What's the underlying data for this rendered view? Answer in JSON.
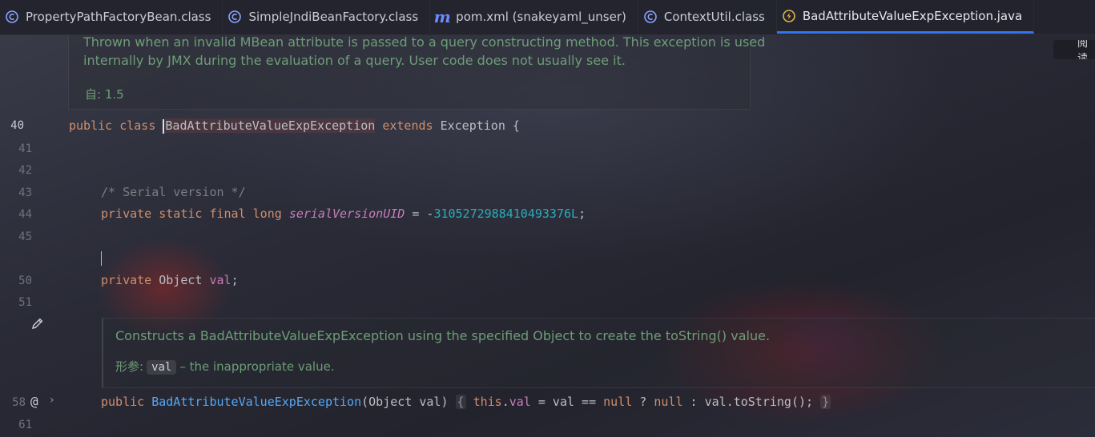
{
  "tabs": [
    {
      "label": "PropertyPathFactoryBean.class",
      "icon": "class-file-icon",
      "active": false
    },
    {
      "label": "SimpleJndiBeanFactory.class",
      "icon": "class-file-icon",
      "active": false
    },
    {
      "label": "pom.xml (snakeyaml_unser)",
      "icon": "maven-icon",
      "active": false
    },
    {
      "label": "ContextUtil.class",
      "icon": "class-file-icon",
      "active": false
    },
    {
      "label": "BadAttributeValueExpException.java",
      "icon": "exception-class-icon",
      "active": true
    }
  ],
  "reader_mode_label": "阅读",
  "doc_top": {
    "line1": "Thrown when an invalid MBean attribute is passed to a query constructing method. This exception is used",
    "line2": "internally by JMX during the evaluation of a query. User code does not usually see it.",
    "since": "自: 1.5"
  },
  "doc_mid": {
    "line1": "Constructs a BadAttributeValueExpException using the specified Object to create the toString() value.",
    "param_label": "形参:",
    "param_name": "val",
    "param_desc": "– the inappropriate value."
  },
  "line_numbers": {
    "l40": "40",
    "l41": "41",
    "l42": "42",
    "l43": "43",
    "l44": "44",
    "l45": "45",
    "l50": "50",
    "l51": "51",
    "l58": "58",
    "l61": "61"
  },
  "code": {
    "l40": {
      "kw1": "public class ",
      "name": "BadAttributeValueExpException",
      "kw2": " extends ",
      "rest": "Exception {"
    },
    "l43": {
      "comment": "/* Serial version */"
    },
    "l44": {
      "kw": "private static final long ",
      "field": "serialVersionUID",
      "eq": " = -",
      "num": "3105272988410493376L",
      "end": ";"
    },
    "l50": {
      "kw": "private ",
      "type": "Object ",
      "field": "val",
      "end": ";"
    },
    "l58": {
      "kw": "public ",
      "name": "BadAttributeValueExpException",
      "params": "(Object val) ",
      "open": "{",
      "this": " this",
      "dot": ".",
      "field": "val",
      "mid1": " = val == ",
      "null1": "null",
      "q": " ? ",
      "null2": "null",
      "mid2": " : val.toString(); ",
      "close": "}"
    }
  }
}
